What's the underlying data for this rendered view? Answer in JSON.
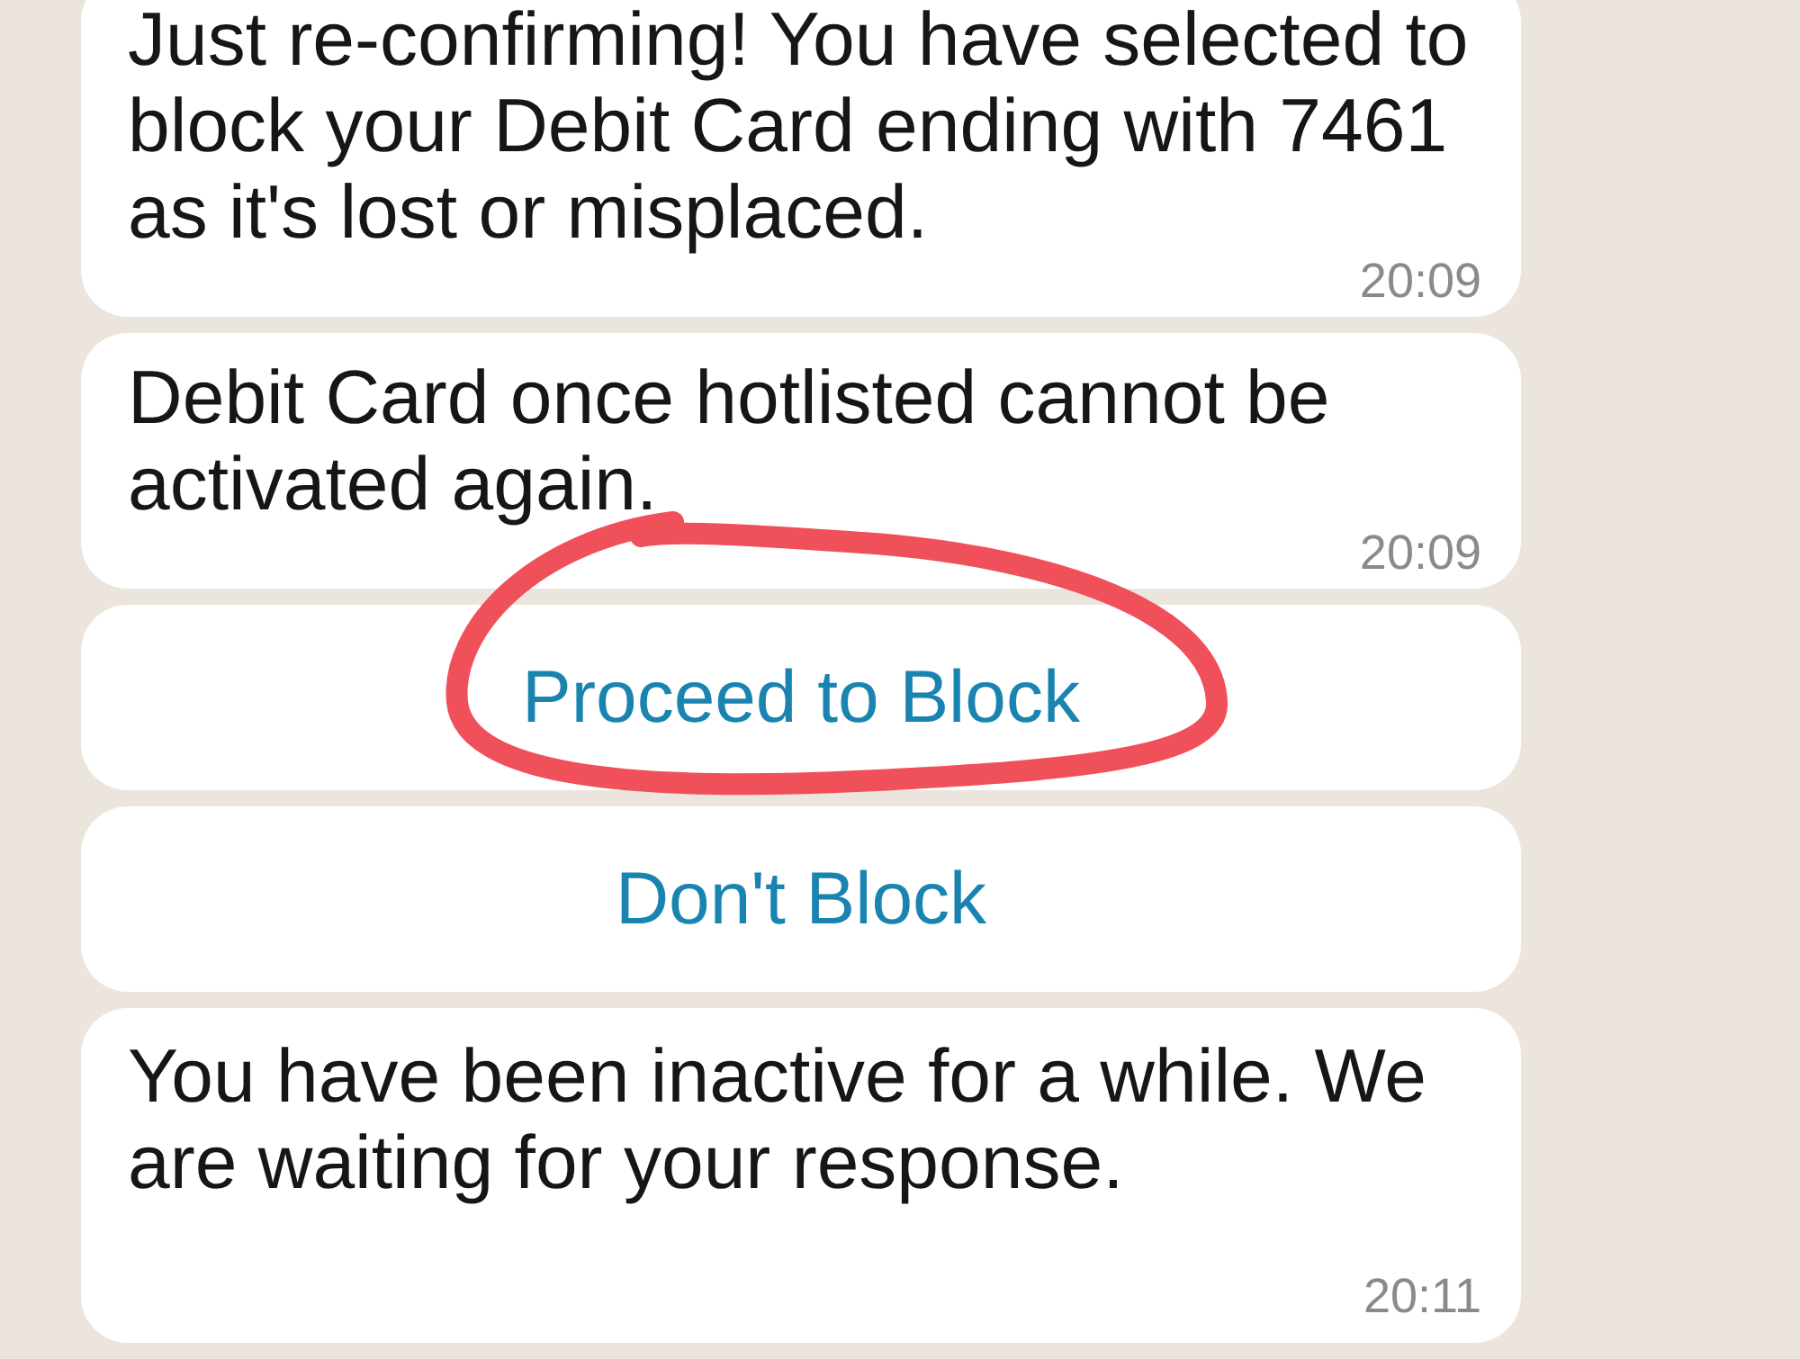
{
  "messages": [
    {
      "kind": "text",
      "text": "Just re-confirming! You have selected to block your Debit Card ending with 7461 as it's lost or misplaced.",
      "time": "20:09"
    },
    {
      "kind": "text",
      "text": "Debit Card once hotlisted cannot be activated again.",
      "time": "20:09"
    },
    {
      "kind": "button",
      "label": "Proceed to Block"
    },
    {
      "kind": "button",
      "label": "Don't Block"
    },
    {
      "kind": "text",
      "text": "You have been inactive for a while. We are waiting for your response.",
      "time": "20:11"
    }
  ],
  "annotation": {
    "kind": "ellipse",
    "color": "#f0505a"
  }
}
